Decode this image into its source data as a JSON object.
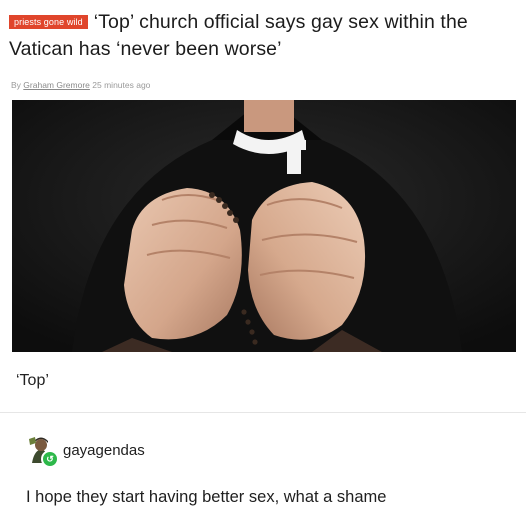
{
  "article": {
    "tag": "priests gone wild",
    "headline": "‘Top’ church official says gay sex within the Vatican has ‘never been worse’",
    "byline_prefix": "By",
    "author": "Graham Gremore",
    "timestamp": "25 minutes ago"
  },
  "caption": "‘Top’",
  "reply": {
    "username": "gayagendas",
    "text": "I hope they start having better sex, what a shame"
  },
  "colors": {
    "tag_bg": "#e0452b",
    "online_badge": "#2db84a"
  },
  "icons": {
    "avatar": "user-avatar-icon",
    "badge": "online-badge-icon"
  }
}
